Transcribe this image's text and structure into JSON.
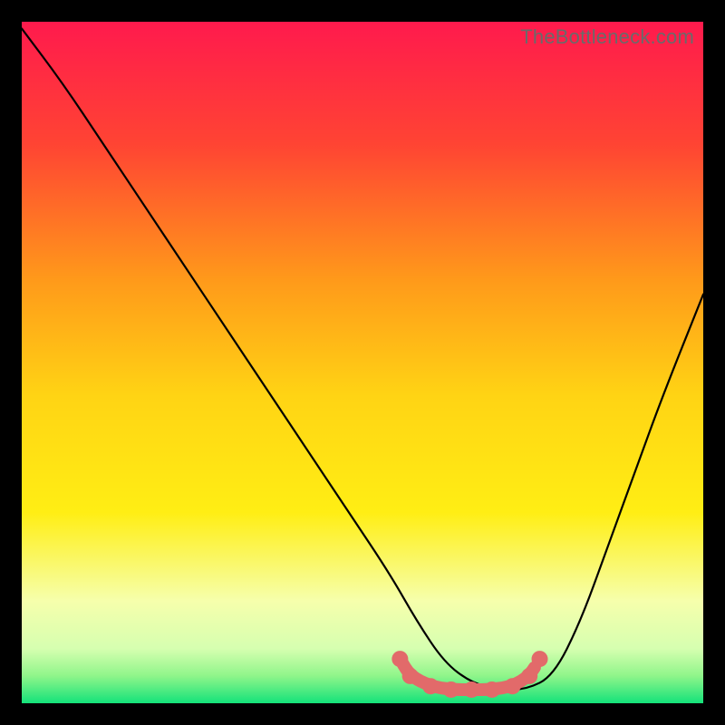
{
  "watermark": "TheBottleneck.com",
  "chart_data": {
    "type": "line",
    "title": "",
    "xlabel": "",
    "ylabel": "",
    "xlim": [
      0,
      100
    ],
    "ylim": [
      0,
      100
    ],
    "gradient_colors": {
      "top": "#ff1a4d",
      "upper_mid": "#ff8c1a",
      "mid": "#ffe914",
      "lower_mid": "#f5ffb0",
      "bottom_band": "#b8ff7e",
      "bottom": "#14e27a"
    },
    "series": [
      {
        "name": "bottleneck-curve",
        "color": "#000000",
        "x": [
          0,
          6,
          12,
          18,
          24,
          30,
          36,
          42,
          48,
          54,
          58,
          62,
          66,
          70,
          74,
          78,
          82,
          86,
          90,
          94,
          100
        ],
        "y": [
          99,
          91,
          82,
          73,
          64,
          55,
          46,
          37,
          28,
          19,
          12,
          6,
          3,
          2,
          2,
          4,
          12,
          23,
          34,
          45,
          60
        ]
      },
      {
        "name": "optimal-marker-dots",
        "color": "#e26a6a",
        "type": "scatter",
        "x": [
          55.5,
          57.0,
          60.0,
          63.0,
          66.0,
          69.0,
          72.0,
          74.5,
          76.0
        ],
        "y": [
          6.5,
          4.0,
          2.5,
          2.0,
          2.0,
          2.0,
          2.5,
          4.0,
          6.5
        ]
      }
    ]
  }
}
